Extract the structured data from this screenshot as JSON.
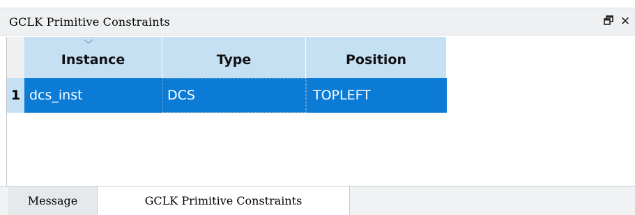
{
  "panel": {
    "title": "GCLK Primitive Constraints",
    "restore_icon": "restore-window-icon",
    "close_icon": "close-icon"
  },
  "table": {
    "columns": [
      "Instance",
      "Type",
      "Position"
    ],
    "rows": [
      {
        "index": "1",
        "instance": "dcs_inst",
        "type": "DCS",
        "position": "TOPLEFT"
      }
    ]
  },
  "tabs": {
    "items": [
      "Message",
      "GCLK Primitive Constraints"
    ],
    "active": "GCLK Primitive Constraints"
  },
  "colors": {
    "header_bg": "#c5dff3",
    "selection_bg": "#0c7bd6",
    "selection_text": "#ffffff"
  }
}
